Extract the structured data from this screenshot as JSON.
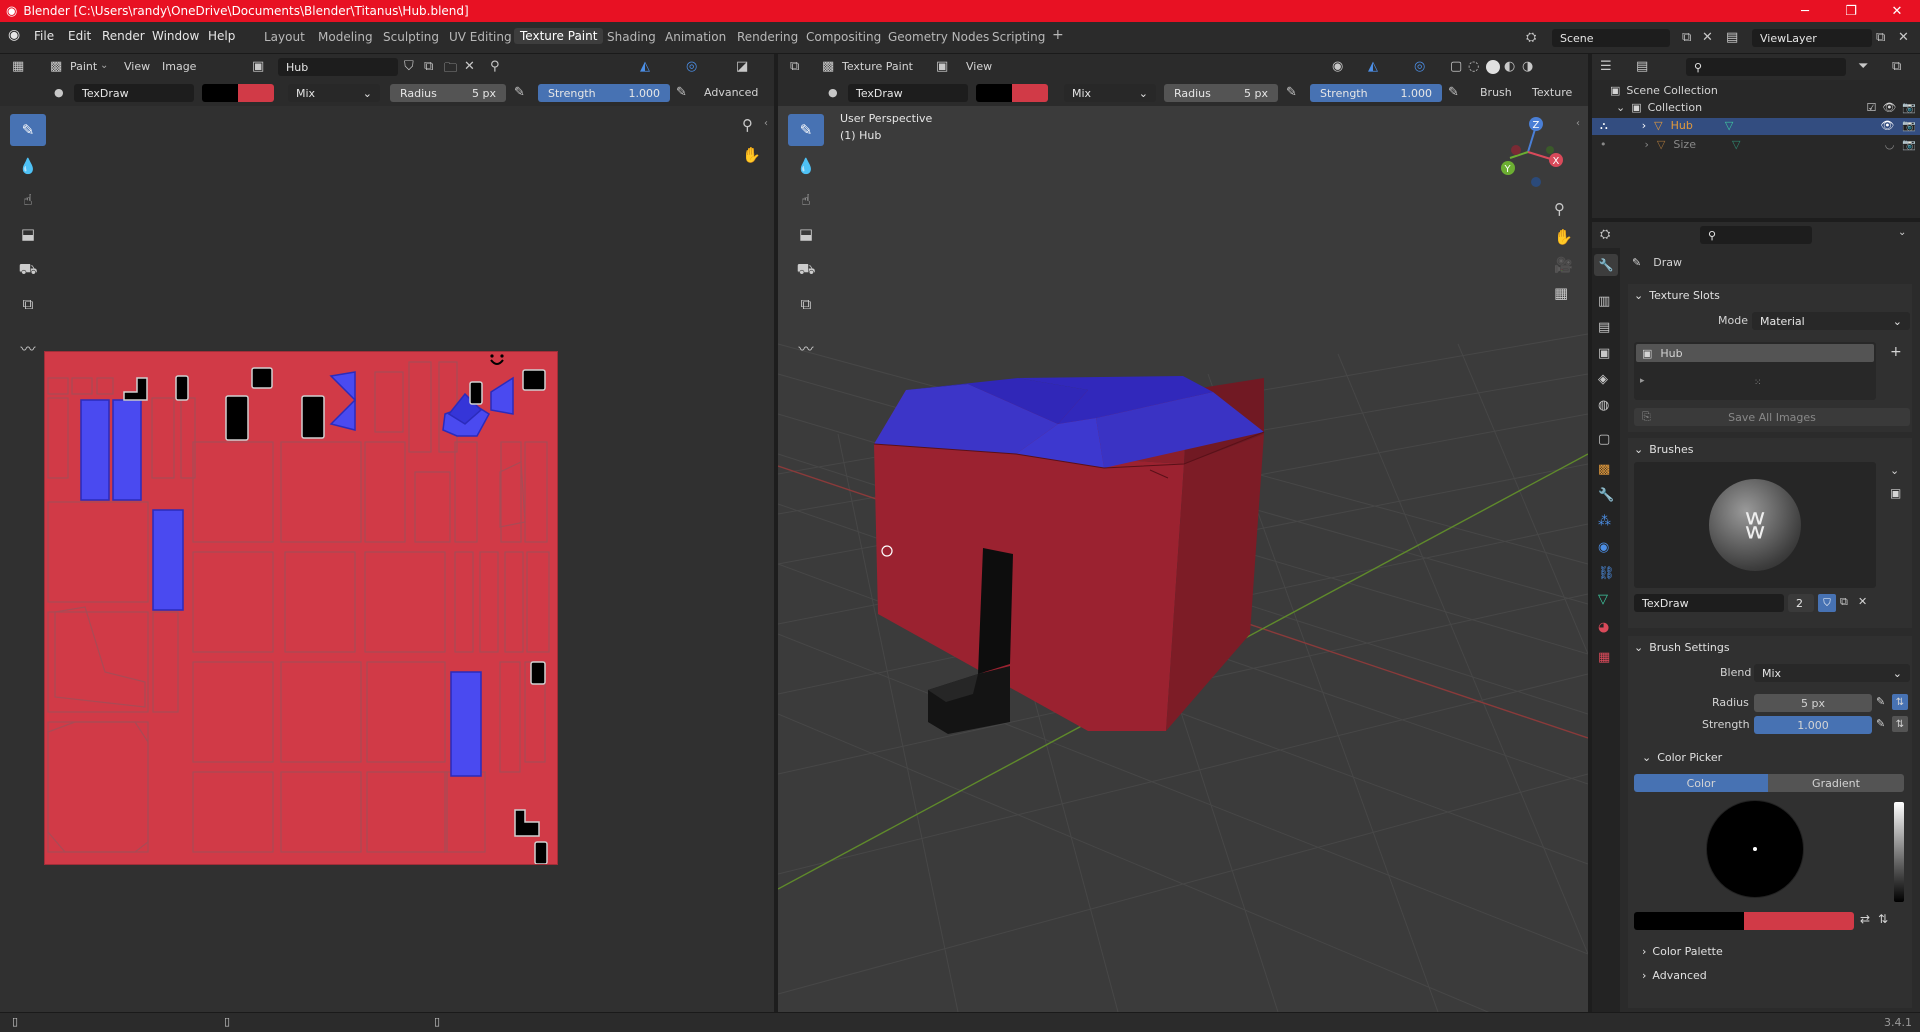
{
  "title_bar": {
    "text": "Blender [C:\\Users\\randy\\OneDrive\\Documents\\Blender\\Titanus\\Hub.blend]",
    "color": "#e81123"
  },
  "top_menu": [
    "File",
    "Edit",
    "Render",
    "Window",
    "Help"
  ],
  "workspaces": [
    "Layout",
    "Modeling",
    "Sculpting",
    "UV Editing",
    "Texture Paint",
    "Shading",
    "Animation",
    "Rendering",
    "Compositing",
    "Geometry Nodes",
    "Scripting"
  ],
  "active_workspace": "Texture Paint",
  "add_workspace": "+",
  "scene": {
    "label": "Scene",
    "view_layer": "ViewLayer"
  },
  "image_editor": {
    "mode": "Paint",
    "menus": [
      "View",
      "Image"
    ],
    "image_name": "Hub",
    "brush": "TexDraw",
    "blend": "Mix",
    "radius_label": "Radius",
    "radius_value": "5 px",
    "strength_label": "Strength",
    "strength_value": "1.000",
    "advanced": "Advanced"
  },
  "viewport": {
    "mode": "Texture Paint",
    "menu": "View",
    "brush": "TexDraw",
    "blend": "Mix",
    "radius_label": "Radius",
    "radius_value": "5 px",
    "strength_label": "Strength",
    "strength_value": "1.000",
    "brush_menu": "Brush",
    "texture_menu": "Texture",
    "perspective": "User Perspective",
    "object": "(1) Hub"
  },
  "outliner": {
    "scene_collection": "Scene Collection",
    "collection": "Collection",
    "items": [
      {
        "name": "Hub",
        "selected": true
      },
      {
        "name": "Size",
        "selected": false
      }
    ]
  },
  "properties": {
    "tool_name": "Draw",
    "texture_slots_header": "Texture Slots",
    "mode_label": "Mode",
    "mode_value": "Material",
    "slot_name": "Hub",
    "save_all_images": "Save All Images",
    "brushes_header": "Brushes",
    "brush_name": "TexDraw",
    "brush_users": "2",
    "brush_settings_header": "Brush Settings",
    "blend_label": "Blend",
    "blend_value": "Mix",
    "radius_label": "Radius",
    "radius_value": "5 px",
    "strength_label": "Strength",
    "strength_value": "1.000",
    "color_picker_header": "Color Picker",
    "color_tab": "Color",
    "gradient_tab": "Gradient",
    "color_palette_header": "Color Palette",
    "advanced_header": "Advanced"
  },
  "colors": {
    "primary": "#000000",
    "secondary": "#d13a47",
    "accent": "#4772b3"
  },
  "status_bar": {
    "version": "3.4.1"
  }
}
